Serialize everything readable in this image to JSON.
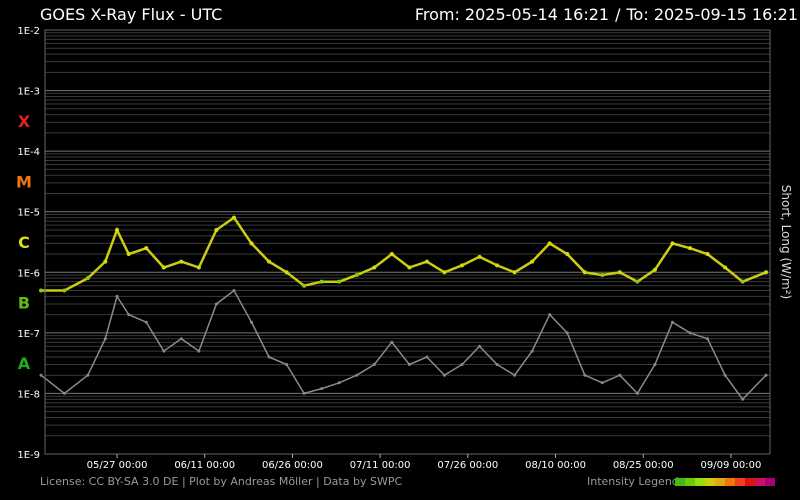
{
  "header": {
    "title": "GOES X-Ray Flux - UTC",
    "from_label": "From: 2025-05-14 16:21",
    "separator": "/",
    "to_label": "To: 2025-09-15 16:21"
  },
  "footer": {
    "license": "License: CC BY-SA 3.0 DE | Plot by Andreas Möller | Data by SWPC",
    "legend_label": "Intensity Legend",
    "legend_colors": [
      "#44bb11",
      "#66cc11",
      "#99dd11",
      "#cccc11",
      "#ddaa11",
      "#ee7711",
      "#ee4411",
      "#dd1111",
      "#cc1166",
      "#aa0077"
    ]
  },
  "chart_data": {
    "type": "line",
    "title": "GOES X-Ray Flux - UTC",
    "ylabel": "Short, Long (W/m²)",
    "yscale": "log",
    "ylim": [
      1e-09,
      0.01
    ],
    "xlim": [
      "2025-05-14 16:21",
      "2025-09-15 16:21"
    ],
    "y_ticks": [
      "1E-2",
      "1E-3",
      "1E-4",
      "1E-5",
      "1E-6",
      "1E-7",
      "1E-8",
      "1E-9"
    ],
    "x_ticks": [
      "05/27 00:00",
      "06/11 00:00",
      "06/26 00:00",
      "07/11 00:00",
      "07/26 00:00",
      "08/10 00:00",
      "08/25 00:00",
      "09/09 00:00"
    ],
    "flare_classes": [
      {
        "label": "X",
        "color": "#dd2222"
      },
      {
        "label": "M",
        "color": "#ee7711"
      },
      {
        "label": "C",
        "color": "#dddd11"
      },
      {
        "label": "B",
        "color": "#66bb11"
      },
      {
        "label": "A",
        "color": "#22aa22"
      }
    ],
    "grid": true,
    "series": [
      {
        "name": "Long",
        "color": "#cccc11",
        "x": [
          "05/14",
          "05/18",
          "05/22",
          "05/25",
          "05/27",
          "05/29",
          "06/01",
          "06/04",
          "06/07",
          "06/10",
          "06/13",
          "06/16",
          "06/19",
          "06/22",
          "06/25",
          "06/28",
          "07/01",
          "07/04",
          "07/07",
          "07/10",
          "07/13",
          "07/16",
          "07/19",
          "07/22",
          "07/25",
          "07/28",
          "07/31",
          "08/03",
          "08/06",
          "08/09",
          "08/12",
          "08/15",
          "08/18",
          "08/21",
          "08/24",
          "08/27",
          "08/30",
          "09/02",
          "09/05",
          "09/08",
          "09/11",
          "09/15"
        ],
        "values": [
          5e-07,
          5e-07,
          8e-07,
          1.5e-06,
          5e-06,
          2e-06,
          2.5e-06,
          1.2e-06,
          1.5e-06,
          1.2e-06,
          5e-06,
          8e-06,
          3e-06,
          1.5e-06,
          1e-06,
          6e-07,
          7e-07,
          7e-07,
          9e-07,
          1.2e-06,
          2e-06,
          1.2e-06,
          1.5e-06,
          1e-06,
          1.3e-06,
          1.8e-06,
          1.3e-06,
          1e-06,
          1.5e-06,
          3e-06,
          2e-06,
          1e-06,
          9e-07,
          1e-06,
          7e-07,
          1.1e-06,
          3e-06,
          2.5e-06,
          2e-06,
          1.2e-06,
          7e-07,
          1e-06
        ]
      },
      {
        "name": "Short",
        "color": "#8a8a8a",
        "x": [
          "05/14",
          "05/18",
          "05/22",
          "05/25",
          "05/27",
          "05/29",
          "06/01",
          "06/04",
          "06/07",
          "06/10",
          "06/13",
          "06/16",
          "06/19",
          "06/22",
          "06/25",
          "06/28",
          "07/01",
          "07/04",
          "07/07",
          "07/10",
          "07/13",
          "07/16",
          "07/19",
          "07/22",
          "07/25",
          "07/28",
          "07/31",
          "08/03",
          "08/06",
          "08/09",
          "08/12",
          "08/15",
          "08/18",
          "08/21",
          "08/24",
          "08/27",
          "08/30",
          "09/02",
          "09/05",
          "09/08",
          "09/11",
          "09/15"
        ],
        "values": [
          2e-08,
          1e-08,
          2e-08,
          8e-08,
          4e-07,
          2e-07,
          1.5e-07,
          5e-08,
          8e-08,
          5e-08,
          3e-07,
          5e-07,
          1.5e-07,
          4e-08,
          3e-08,
          1e-08,
          1.2e-08,
          1.5e-08,
          2e-08,
          3e-08,
          7e-08,
          3e-08,
          4e-08,
          2e-08,
          3e-08,
          6e-08,
          3e-08,
          2e-08,
          5e-08,
          2e-07,
          1e-07,
          2e-08,
          1.5e-08,
          2e-08,
          1e-08,
          3e-08,
          1.5e-07,
          1e-07,
          8e-08,
          2e-08,
          8e-09,
          2e-08
        ]
      }
    ]
  }
}
